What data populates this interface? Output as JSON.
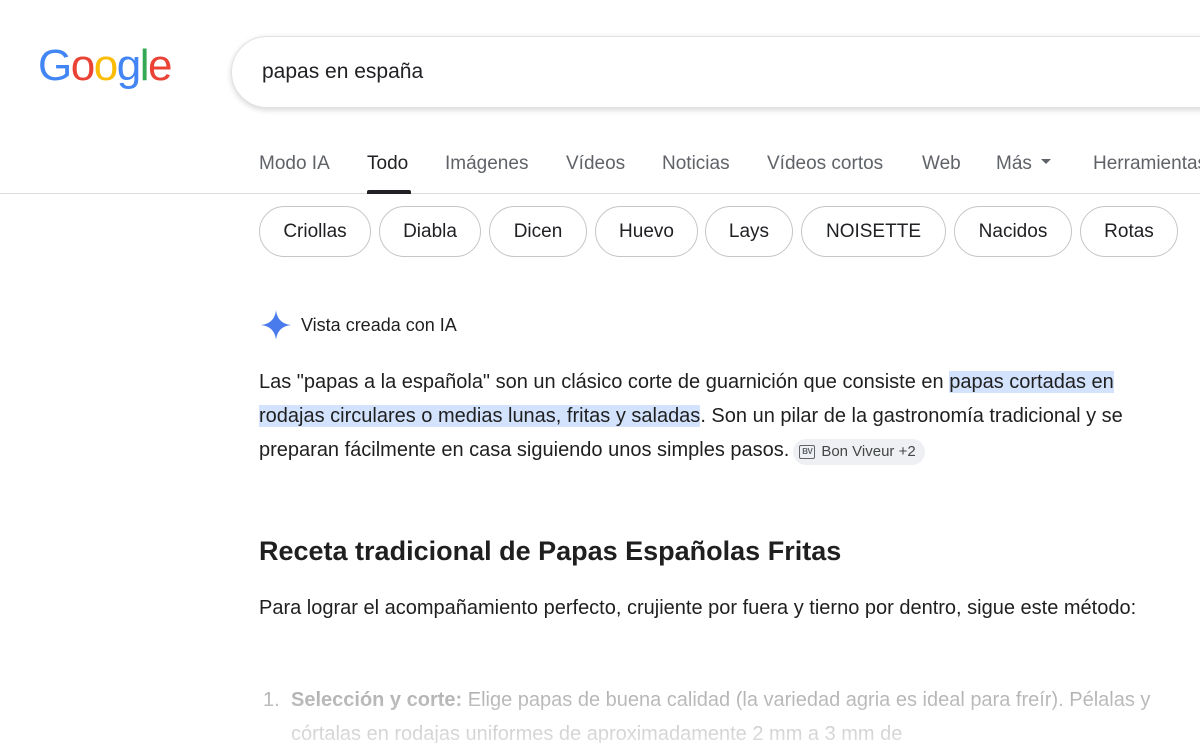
{
  "logo": {
    "letters": [
      "G",
      "o",
      "o",
      "g",
      "l",
      "e"
    ],
    "colors": [
      "#4285F4",
      "#EA4335",
      "#FBBC05",
      "#4285F4",
      "#34A853",
      "#EA4335"
    ]
  },
  "search": {
    "query": "papas en españa"
  },
  "tabs": [
    {
      "label": "Modo IA"
    },
    {
      "label": "Todo"
    },
    {
      "label": "Imágenes"
    },
    {
      "label": "Vídeos"
    },
    {
      "label": "Noticias"
    },
    {
      "label": "Vídeos cortos"
    },
    {
      "label": "Web"
    },
    {
      "label": "Más"
    },
    {
      "label": "Herramientas"
    }
  ],
  "active_tab": "Todo",
  "chips": [
    "Criollas",
    "Diabla",
    "Dicen",
    "Huevo",
    "Lays",
    "NOISETTE",
    "Nacidos",
    "Rotas"
  ],
  "ai_overview": {
    "title": "Vista creada con IA",
    "text_before": "Las \"papas a la española\" son un clásico corte de guarnición que consiste en ",
    "text_highlight": "papas cortadas en rodajas circulares o medias lunas, fritas y saladas",
    "text_after": ". Son un pilar de la gastronomía tradicional y se preparan fácilmente en casa siguiendo unos simples pasos.",
    "source_icon_text": "BV",
    "source_label": "Bon Viveur +2"
  },
  "recipe": {
    "heading": "Receta tradicional de Papas Españolas Fritas",
    "intro": "Para lograr el acompañamiento perfecto, crujiente por fuera y tierno por dentro, sigue este método:",
    "steps": [
      {
        "number": "1.",
        "title": "Selección y corte:",
        "text": " Elige papas de buena calidad (la variedad agria es ideal para freír). Pélalas y córtalas en rodajas uniformes de aproximadamente 2 mm a 3 mm de"
      }
    ]
  },
  "colors": {
    "highlight": "#d3e3fd",
    "sparkle": "#4a7bec",
    "text": "#1f1f1f"
  }
}
